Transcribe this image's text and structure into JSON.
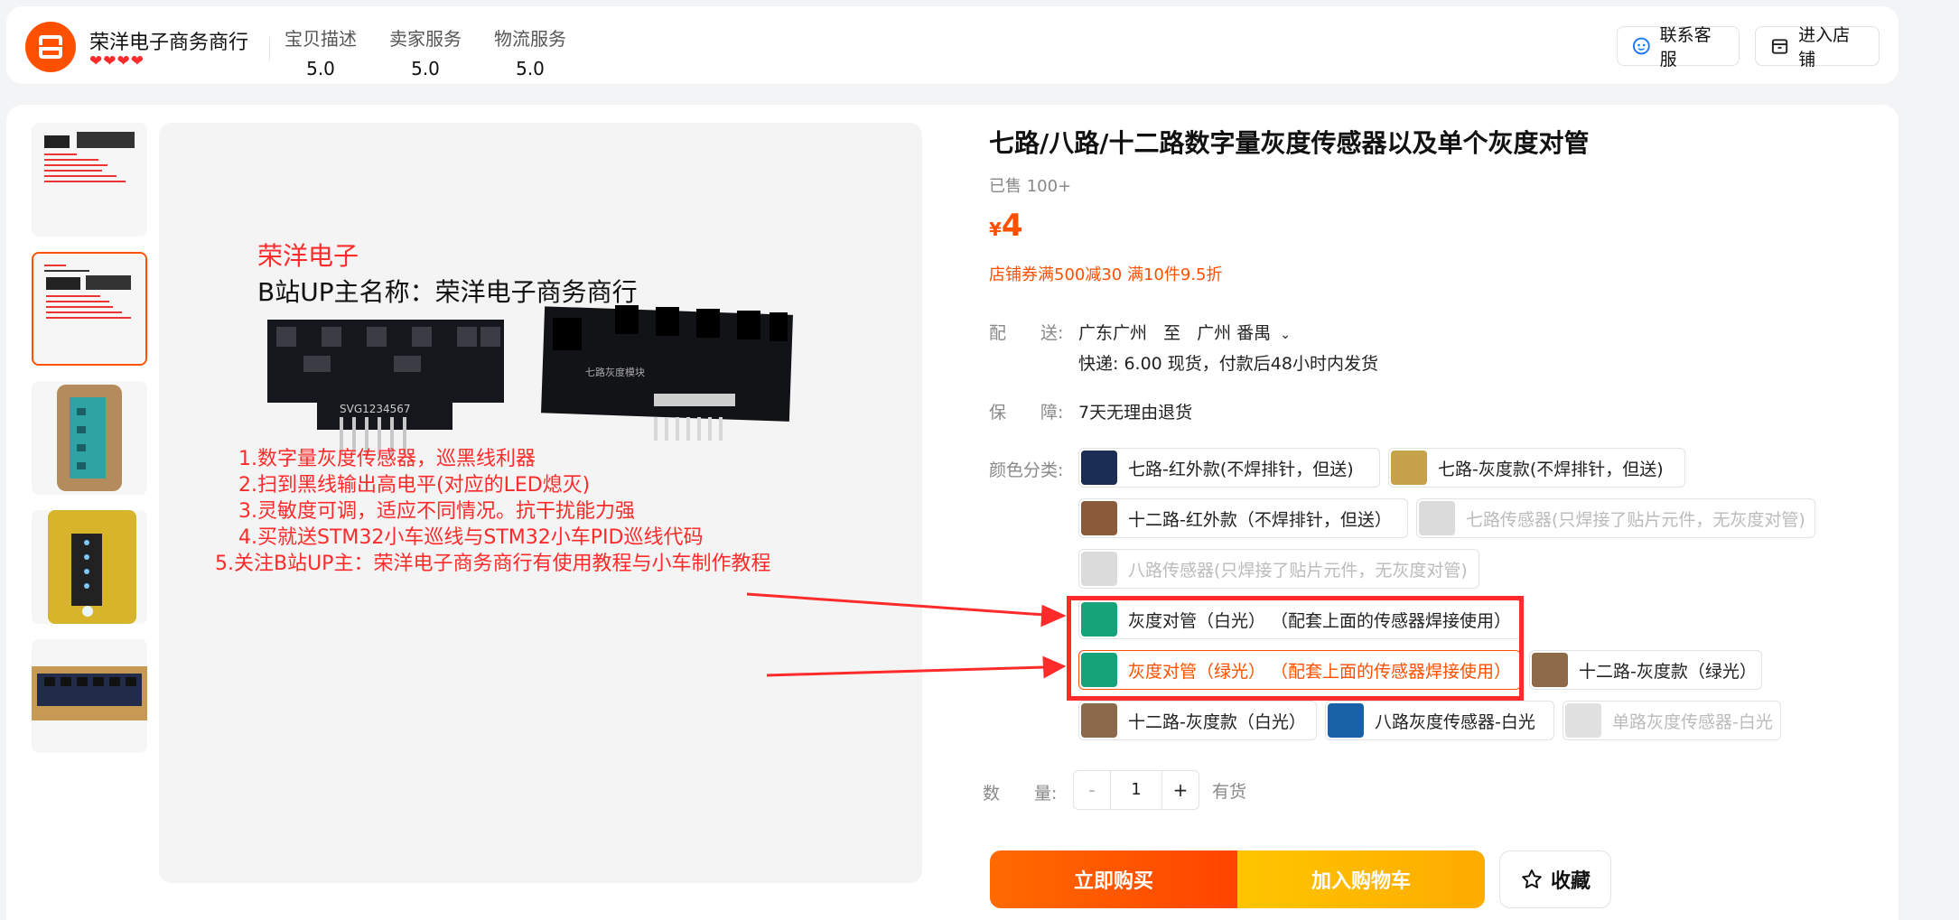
{
  "shop": {
    "name": "荣洋电子商务商行",
    "scores": [
      {
        "label": "宝贝描述",
        "value": "5.0"
      },
      {
        "label": "卖家服务",
        "value": "5.0"
      },
      {
        "label": "物流服务",
        "value": "5.0"
      }
    ],
    "contact_label": "联系客服",
    "enter_label": "进入店铺"
  },
  "image": {
    "brand": "荣洋电子",
    "up_line": "B站UP主名称：荣洋电子商务商行",
    "board_text": "七路灰度模块",
    "pcb_label": "SVG1234567",
    "points": [
      "1.数字量灰度传感器，巡黑线利器",
      "2.扫到黑线输出高电平(对应的LED熄灭)",
      "3.灵敏度可调，适应不同情况。抗干扰能力强",
      "4.买就送STM32小车巡线与STM32小车PID巡线代码",
      "5.关注B站UP主：荣洋电子商务商行有使用教程与小车制作教程"
    ]
  },
  "product": {
    "title": "七路/八路/十二路数字量灰度传感器以及单个灰度对管",
    "sold": "已售 100+",
    "currency": "¥",
    "price": "4",
    "promo": "店铺券满500减30 满10件9.5折"
  },
  "delivery": {
    "label": "配　　送:",
    "from": "广东广州",
    "to_word": "至",
    "to": "广州 番禺",
    "shipping": "快递: 6.00   现货，付款后48小时内发货"
  },
  "guarantee": {
    "label": "保　　障:",
    "value": "7天无理由退货"
  },
  "color": {
    "label": "颜色分类:",
    "options": [
      "七路-红外款(不焊排针，但送)",
      "七路-灰度款(不焊排针，但送)",
      "十二路-红外款（不焊排针，但送）",
      "七路传感器(只焊接了贴片元件，无灰度对管)",
      "八路传感器(只焊接了贴片元件，无灰度对管)",
      "灰度对管（白光） （配套上面的传感器焊接使用）",
      "灰度对管（绿光） （配套上面的传感器焊接使用）",
      "十二路-灰度款（绿光）",
      "十二路-灰度款（白光）",
      "八路灰度传感器-白光",
      "单路灰度传感器-白光"
    ]
  },
  "quantity": {
    "label": "数　　量:",
    "minus": "-",
    "value": "1",
    "plus": "+",
    "stock": "有货"
  },
  "actions": {
    "buy_now": "立即购买",
    "add_cart": "加入购物车",
    "favorite": "收藏"
  },
  "colors": {
    "accent": "#ff5000",
    "highlight_box": "#ff2a2a",
    "heart": "#ff2a2a"
  }
}
